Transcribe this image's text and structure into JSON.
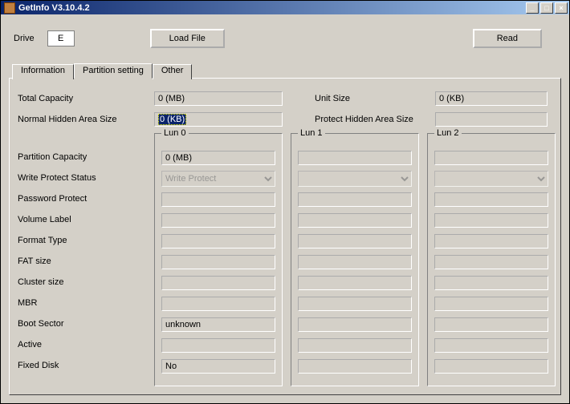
{
  "window": {
    "title": "GetInfo V3.10.4.2",
    "minimize": "_",
    "maximize": "□",
    "close": "×"
  },
  "top": {
    "driveLabel": "Drive",
    "driveValue": "E",
    "loadFile": "Load File",
    "read": "Read"
  },
  "tabs": {
    "information": "Information",
    "partition": "Partition setting",
    "other": "Other"
  },
  "upper": {
    "totalCapacityLabel": "Total Capacity",
    "totalCapacity": "0 (MB)",
    "unitSizeLabel": "Unit Size",
    "unitSize": "0 (KB)",
    "normalHiddenLabel": "Normal Hidden Area Size",
    "normalHidden": "0 (KB)",
    "protectHiddenLabel": "Protect Hidden Area Size",
    "protectHidden": ""
  },
  "rowLabels": {
    "partitionCapacity": "Partition Capacity",
    "writeProtect": "Write Protect Status",
    "passwordProtect": "Password Protect",
    "volumeLabel": "Volume Label",
    "formatType": "Format Type",
    "fatSize": "FAT size",
    "clusterSize": "Cluster size",
    "mbr": "MBR",
    "bootSector": "Boot Sector",
    "active": "Active",
    "fixedDisk": "Fixed Disk"
  },
  "luns": {
    "lun0": {
      "title": "Lun 0",
      "partitionCapacity": "0 (MB)",
      "writeProtect": "Write Protect",
      "passwordProtect": "",
      "volumeLabel": "",
      "formatType": "",
      "fatSize": "",
      "clusterSize": "",
      "mbr": "",
      "bootSector": "unknown",
      "active": "",
      "fixedDisk": "No"
    },
    "lun1": {
      "title": "Lun 1",
      "partitionCapacity": "",
      "writeProtect": "",
      "passwordProtect": "",
      "volumeLabel": "",
      "formatType": "",
      "fatSize": "",
      "clusterSize": "",
      "mbr": "",
      "bootSector": "",
      "active": "",
      "fixedDisk": ""
    },
    "lun2": {
      "title": "Lun 2",
      "partitionCapacity": "",
      "writeProtect": "",
      "passwordProtect": "",
      "volumeLabel": "",
      "formatType": "",
      "fatSize": "",
      "clusterSize": "",
      "mbr": "",
      "bootSector": "",
      "active": "",
      "fixedDisk": ""
    }
  }
}
